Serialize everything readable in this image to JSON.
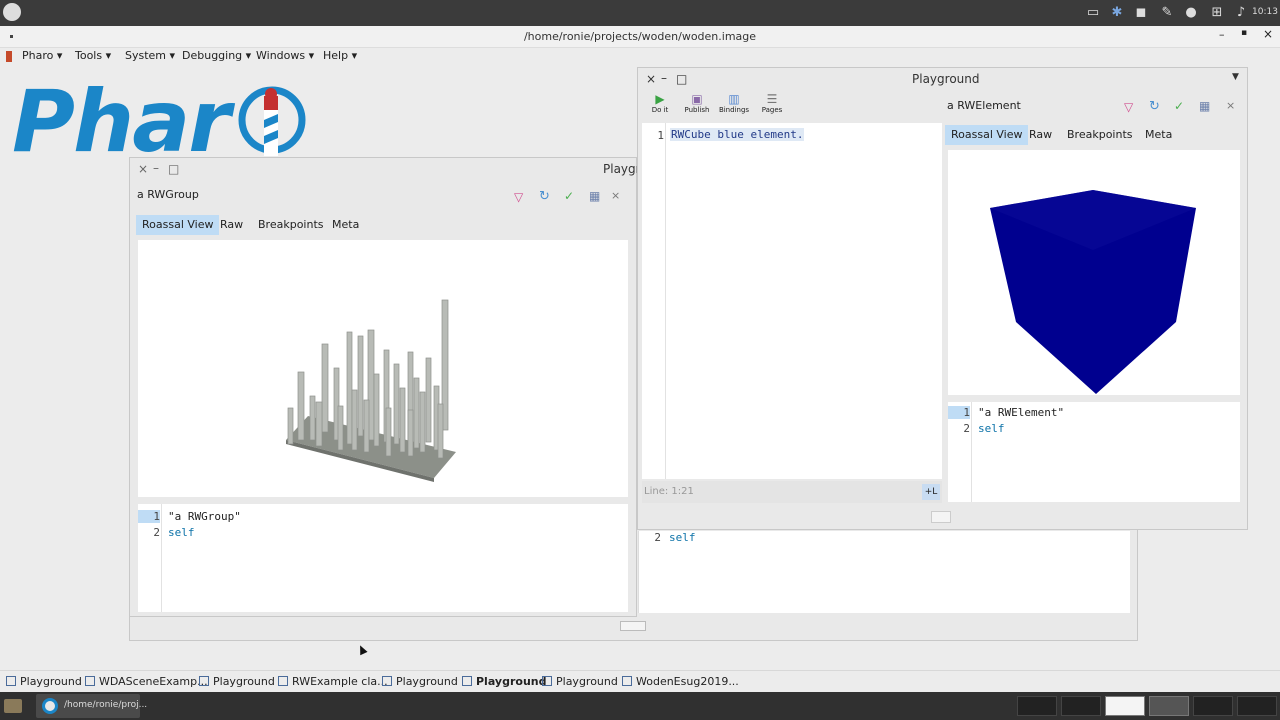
{
  "os_panel": {
    "clock": "10:13"
  },
  "window": {
    "title": "/home/ronie/projects/woden/woden.image"
  },
  "menu": [
    "Pharo",
    "Tools",
    "System",
    "Debugging",
    "Windows",
    "Help"
  ],
  "logo_text": "Phar",
  "left_playground": {
    "title": "Playgr",
    "object_label": "a RWGroup",
    "tabs": [
      "Roassal View",
      "Raw",
      "Breakpoints",
      "Meta"
    ],
    "code_lines": [
      "\"a RWGroup\"",
      "self"
    ],
    "line_numbers": [
      "1",
      "2"
    ]
  },
  "behind_pane": {
    "partial_code": "self",
    "line_number": "2"
  },
  "right_playground": {
    "title": "Playground",
    "toolbar": [
      "Do it",
      "Publish",
      "Bindings",
      "Pages"
    ],
    "code": "RWCube blue element.",
    "line_number": "1",
    "status": "Line: 1:21",
    "status_btn": "+L",
    "inspector": {
      "object_label": "a RWElement",
      "tabs": [
        "Roassal View",
        "Raw",
        "Breakpoints",
        "Meta"
      ],
      "code_lines": [
        "\"a RWElement\"",
        "self"
      ],
      "line_numbers": [
        "1",
        "2"
      ]
    }
  },
  "taskbar": [
    {
      "label": "Playground",
      "active": false
    },
    {
      "label": "WDASceneExamp...",
      "active": false
    },
    {
      "label": "Playground",
      "active": false
    },
    {
      "label": "RWExample cla...",
      "active": false
    },
    {
      "label": "Playground",
      "active": false
    },
    {
      "label": "Playground",
      "active": true
    },
    {
      "label": "Playground",
      "active": false
    },
    {
      "label": "WodenEsug2019...",
      "active": false
    }
  ],
  "os_taskbar": {
    "app_label": "/home/ronie/proj..."
  },
  "colors": {
    "accent": "#bfdcf5",
    "cube": "#00008f",
    "logo": "#1b86c8"
  }
}
